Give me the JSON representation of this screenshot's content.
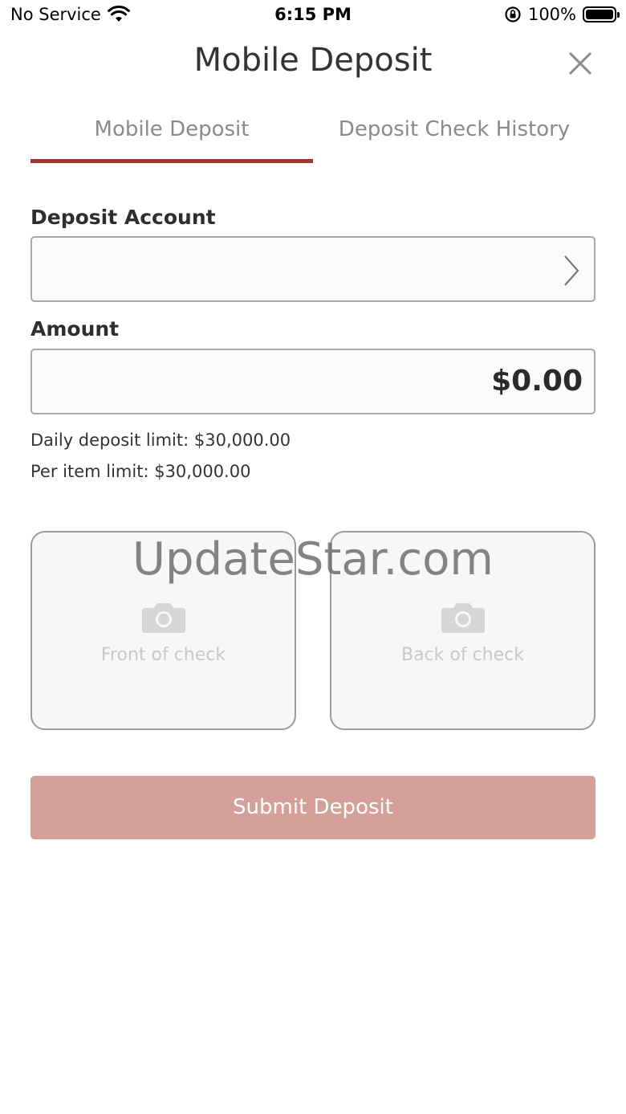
{
  "status_bar": {
    "carrier": "No Service",
    "time": "6:15 PM",
    "battery": "100%",
    "icons": [
      "wifi-icon",
      "orientation-lock-icon",
      "battery-icon"
    ]
  },
  "header": {
    "title": "Mobile Deposit",
    "close_icon": "close-icon"
  },
  "tabs": [
    {
      "label": "Mobile Deposit",
      "active": true
    },
    {
      "label": "Deposit Check History",
      "active": false
    }
  ],
  "form": {
    "deposit_account_label": "Deposit Account",
    "deposit_account_value": "",
    "amount_label": "Amount",
    "amount_value": "$0.00",
    "daily_limit": "Daily deposit limit: $30,000.00",
    "per_item_limit": "Per item limit: $30,000.00"
  },
  "check_images": {
    "front_label": "Front of check",
    "back_label": "Back of check",
    "icon": "camera-icon"
  },
  "watermark": "UpdateStar.com",
  "submit_label": "Submit Deposit",
  "colors": {
    "accent": "#a0352d",
    "submit_disabled": "#d59f9a"
  }
}
